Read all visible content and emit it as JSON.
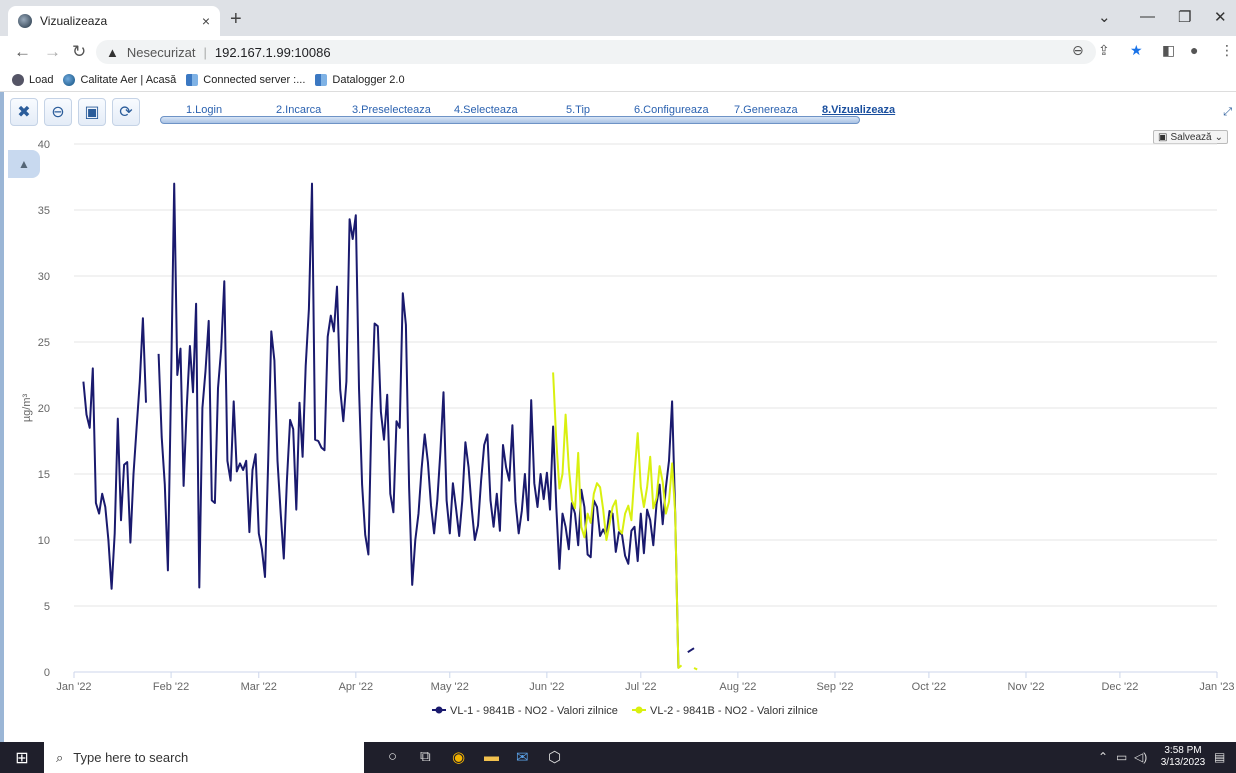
{
  "browser": {
    "tab_title": "Vizualizeaza",
    "tab_close": "×",
    "new_tab": "+",
    "insecure_label": "Nesecurizat",
    "separator": "|",
    "url": "192.167.1.99:10086",
    "bookmarks": [
      {
        "label": "Load",
        "icon": "globe-dark-icon"
      },
      {
        "label": "Calitate Aer | Acasă",
        "icon": "globe-icon"
      },
      {
        "label": "Connected server :...",
        "icon": "datalogger-icon"
      },
      {
        "label": "Datalogger 2.0",
        "icon": "datalogger-icon"
      }
    ]
  },
  "app": {
    "steps": [
      {
        "label": "1.Login"
      },
      {
        "label": "2.Incarca"
      },
      {
        "label": "3.Preselecteaza"
      },
      {
        "label": "4.Selecteaza"
      },
      {
        "label": "5.Tip"
      },
      {
        "label": "6.Configureaza"
      },
      {
        "label": "7.Genereaza"
      },
      {
        "label": "8.Vizualizeaza"
      }
    ],
    "active_step": "8.Vizualizeaza",
    "save_menu_label": "Salvează"
  },
  "chart_data": {
    "type": "line",
    "ylabel": "µg/m³",
    "ylim": [
      0,
      40
    ],
    "yticks": [
      0,
      5,
      10,
      15,
      20,
      25,
      30,
      35,
      40
    ],
    "xlim": [
      "2022-01-01",
      "2023-01-01"
    ],
    "xticks": [
      "Jan '22",
      "Feb '22",
      "Mar '22",
      "Apr '22",
      "May '22",
      "Jun '22",
      "Jul '22",
      "Aug '22",
      "Sep '22",
      "Oct '22",
      "Nov '22",
      "Dec '22",
      "Jan '23"
    ],
    "grid": true,
    "legend_position": "bottom-center",
    "series": [
      {
        "name": "VL-1 - 9841B - NO2 - Valori zilnice",
        "color": "#1a1a6e",
        "segments": [
          [
            [
              3,
              22
            ],
            [
              4,
              19.5
            ],
            [
              5,
              18.5
            ],
            [
              6,
              23
            ],
            [
              7,
              12.8
            ],
            [
              8,
              12
            ],
            [
              9,
              13.5
            ],
            [
              10,
              12.5
            ],
            [
              11,
              10
            ],
            [
              12,
              6.3
            ],
            [
              13,
              10.5
            ],
            [
              14,
              19.2
            ],
            [
              15,
              11.5
            ],
            [
              16,
              15.7
            ],
            [
              17,
              15.9
            ],
            [
              18,
              9.8
            ],
            [
              19,
              15
            ],
            [
              20,
              18.5
            ],
            [
              21,
              22
            ],
            [
              22,
              26.8
            ],
            [
              23,
              20.4
            ]
          ],
          [
            [
              27,
              24.1
            ],
            [
              28,
              17.8
            ],
            [
              29,
              14.2
            ],
            [
              30,
              7.7
            ],
            [
              31,
              22
            ],
            [
              32,
              37
            ],
            [
              33,
              22.5
            ],
            [
              34,
              24.5
            ],
            [
              35,
              14.1
            ],
            [
              36,
              20
            ],
            [
              37,
              24.7
            ],
            [
              38,
              21.2
            ],
            [
              39,
              27.9
            ],
            [
              40,
              6.4
            ],
            [
              41,
              20
            ],
            [
              42,
              22.8
            ],
            [
              43,
              26.6
            ],
            [
              44,
              13
            ],
            [
              45,
              12.8
            ],
            [
              46,
              21.5
            ],
            [
              47,
              24.5
            ],
            [
              48,
              29.6
            ],
            [
              49,
              16
            ],
            [
              50,
              14.5
            ],
            [
              51,
              20.5
            ],
            [
              52,
              15.2
            ],
            [
              53,
              15.8
            ],
            [
              54,
              15.3
            ],
            [
              55,
              16
            ],
            [
              56,
              10.6
            ],
            [
              57,
              15.3
            ],
            [
              58,
              16.5
            ],
            [
              59,
              10.5
            ],
            [
              60,
              9.3
            ],
            [
              61,
              7.2
            ],
            [
              62,
              16
            ],
            [
              63,
              25.8
            ],
            [
              64,
              23.6
            ],
            [
              65,
              16
            ],
            [
              66,
              12
            ],
            [
              67,
              8.6
            ],
            [
              68,
              14.5
            ],
            [
              69,
              19.1
            ],
            [
              70,
              18.4
            ],
            [
              71,
              12.3
            ],
            [
              72,
              20.4
            ],
            [
              73,
              16.3
            ],
            [
              74,
              23.2
            ],
            [
              75,
              27.5
            ],
            [
              76,
              37
            ],
            [
              77,
              17.6
            ],
            [
              78,
              17.5
            ],
            [
              79,
              17
            ],
            [
              80,
              16.8
            ],
            [
              81,
              25.4
            ],
            [
              82,
              27
            ],
            [
              83,
              25.8
            ],
            [
              84,
              29.2
            ],
            [
              85,
              21.4
            ],
            [
              86,
              19
            ],
            [
              87,
              22
            ],
            [
              88,
              34.3
            ],
            [
              89,
              32.8
            ],
            [
              90,
              34.6
            ],
            [
              91,
              21.5
            ],
            [
              92,
              14.2
            ],
            [
              93,
              10.4
            ],
            [
              94,
              8.9
            ],
            [
              95,
              19.5
            ],
            [
              96,
              26.4
            ],
            [
              97,
              26.2
            ],
            [
              98,
              19.7
            ],
            [
              99,
              17.6
            ],
            [
              100,
              21
            ],
            [
              101,
              13.5
            ],
            [
              102,
              12.1
            ],
            [
              103,
              19
            ],
            [
              104,
              18.5
            ],
            [
              105,
              28.7
            ],
            [
              106,
              26.3
            ],
            [
              107,
              14
            ],
            [
              108,
              6.6
            ],
            [
              109,
              10
            ],
            [
              110,
              12
            ],
            [
              111,
              15.4
            ],
            [
              112,
              18
            ],
            [
              113,
              15.9
            ],
            [
              114,
              12.6
            ],
            [
              115,
              10.5
            ],
            [
              116,
              13
            ],
            [
              117,
              16.7
            ],
            [
              118,
              21.2
            ],
            [
              119,
              13
            ],
            [
              120,
              10.5
            ],
            [
              121,
              14.3
            ],
            [
              122,
              12.4
            ],
            [
              123,
              10.3
            ],
            [
              124,
              13
            ],
            [
              125,
              17.4
            ],
            [
              126,
              15.5
            ],
            [
              127,
              12.4
            ],
            [
              128,
              10
            ],
            [
              129,
              11.1
            ],
            [
              130,
              14.5
            ],
            [
              131,
              17.2
            ],
            [
              132,
              18
            ],
            [
              133,
              13
            ],
            [
              134,
              11
            ],
            [
              135,
              13.5
            ],
            [
              136,
              10.7
            ],
            [
              137,
              17.2
            ],
            [
              138,
              15.5
            ],
            [
              139,
              14.5
            ],
            [
              140,
              18.7
            ],
            [
              141,
              12.9
            ],
            [
              142,
              10.5
            ],
            [
              143,
              12.2
            ],
            [
              144,
              15
            ],
            [
              145,
              11.5
            ],
            [
              146,
              20.6
            ],
            [
              147,
              14.3
            ],
            [
              148,
              12.5
            ],
            [
              149,
              15
            ],
            [
              150,
              13.1
            ],
            [
              151,
              15.1
            ],
            [
              152,
              12.3
            ],
            [
              153,
              18.6
            ],
            [
              154,
              12.5
            ],
            [
              155,
              7.8
            ],
            [
              156,
              12
            ],
            [
              157,
              11
            ],
            [
              158,
              9.3
            ],
            [
              159,
              12.8
            ],
            [
              160,
              12
            ],
            [
              161,
              9.6
            ],
            [
              162,
              13.8
            ],
            [
              163,
              12.5
            ],
            [
              164,
              8.9
            ],
            [
              165,
              8.7
            ],
            [
              166,
              13
            ],
            [
              167,
              12.5
            ],
            [
              168,
              10.3
            ],
            [
              169,
              10.8
            ],
            [
              170,
              10.3
            ],
            [
              171,
              12.2
            ],
            [
              172,
              12
            ],
            [
              173,
              9.1
            ],
            [
              174,
              10.6
            ],
            [
              175,
              10.4
            ],
            [
              176,
              8.8
            ],
            [
              177,
              8.2
            ],
            [
              178,
              10.7
            ],
            [
              179,
              11
            ],
            [
              180,
              8.4
            ],
            [
              181,
              12
            ],
            [
              182,
              9
            ],
            [
              183,
              12.3
            ],
            [
              184,
              11.5
            ],
            [
              185,
              9.6
            ],
            [
              186,
              12.7
            ],
            [
              187,
              14.2
            ],
            [
              188,
              11.2
            ],
            [
              189,
              14
            ],
            [
              190,
              16
            ],
            [
              191,
              20.5
            ],
            [
              192,
              12
            ],
            [
              193,
              0.3
            ]
          ],
          [
            [
              196,
              1.5
            ],
            [
              198,
              1.8
            ]
          ]
        ]
      },
      {
        "name": "VL-2 - 9841B - NO2 - Valori zilnice",
        "color": "#d9f00f",
        "segments": [
          [
            [
              153,
              22.7
            ],
            [
              154,
              17.5
            ],
            [
              155,
              13.9
            ],
            [
              156,
              15
            ],
            [
              157,
              19.5
            ],
            [
              158,
              15.5
            ],
            [
              159,
              13
            ],
            [
              160,
              12.4
            ],
            [
              161,
              16.6
            ],
            [
              162,
              11
            ],
            [
              163,
              10.2
            ],
            [
              164,
              12
            ],
            [
              165,
              11.3
            ],
            [
              166,
              13.5
            ],
            [
              167,
              14.3
            ],
            [
              168,
              14
            ],
            [
              169,
              12.3
            ],
            [
              170,
              10
            ],
            [
              171,
              11.2
            ],
            [
              172,
              12.5
            ],
            [
              173,
              13
            ],
            [
              174,
              10.8
            ],
            [
              175,
              10.5
            ],
            [
              176,
              12
            ],
            [
              177,
              12.6
            ],
            [
              178,
              11.5
            ],
            [
              179,
              15
            ],
            [
              180,
              18.1
            ],
            [
              181,
              14
            ],
            [
              182,
              12.5
            ],
            [
              183,
              14
            ],
            [
              184,
              16.3
            ],
            [
              185,
              12.4
            ],
            [
              186,
              13.2
            ],
            [
              187,
              15.6
            ],
            [
              188,
              14.4
            ],
            [
              189,
              12
            ],
            [
              190,
              12.9
            ],
            [
              191,
              15.8
            ],
            [
              192,
              12
            ],
            [
              193,
              0.3
            ],
            [
              194,
              0.5
            ]
          ],
          [
            [
              198,
              0.3
            ],
            [
              199,
              0.2
            ]
          ]
        ]
      }
    ]
  }
}
